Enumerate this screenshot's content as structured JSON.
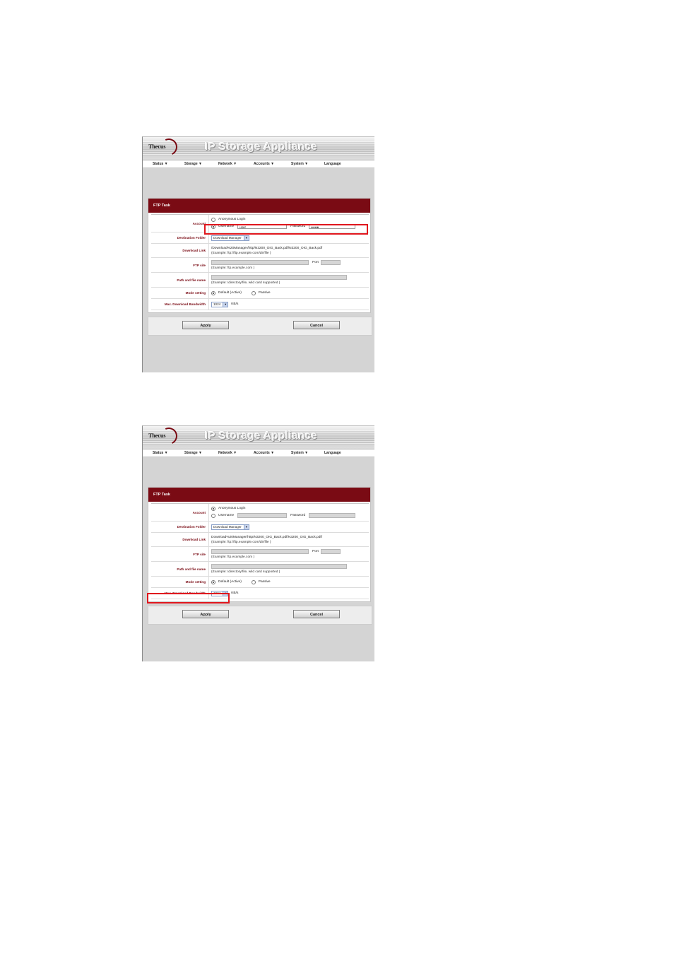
{
  "app": {
    "logo": "Thecus",
    "title": "IP Storage Appliance"
  },
  "menu": [
    "Status ▼",
    "Storage ▼",
    "Network ▼",
    "Accounts ▼",
    "System ▼",
    "Language"
  ],
  "form": {
    "panel_title": "FTP Task",
    "labels": {
      "account": "Account",
      "destination": "Destination Folder",
      "download_link": "Download Link",
      "ftp_site": "FTP site",
      "path": "Path and file name",
      "mode": "Mode setting",
      "bandwidth": "Max. Download Bandwidth"
    },
    "anonymous_label": "Anonymous Login",
    "username_label": "Username",
    "password_label": "Password",
    "destination_value": "Download Manager",
    "link_example": "(Example: ftp://ftp.example.com/dir/file )",
    "port_label": "Port",
    "ftp_example": "(Example: ftp.example.com )",
    "path_example": "(Example: /directory/file, wild card supported )",
    "mode_default": "Default (Active)",
    "mode_passive": "Passive",
    "bandwidth_value": "1024",
    "bandwidth_unit": "KB/s",
    "apply": "Apply",
    "cancel": "Cancel"
  },
  "screens": [
    {
      "username_value": "user",
      "password_value": "●●●●",
      "download_link_value": "/Download%20Manager/http/N3200_OIG_Back.pdf/N3200_OIG_Back.pdf"
    },
    {
      "username_value": "",
      "password_value": "",
      "download_link_value": "Download%20Manager/http/N3200_OIG_Back.pdf/N3200_OIG_Back.pdf/"
    }
  ]
}
